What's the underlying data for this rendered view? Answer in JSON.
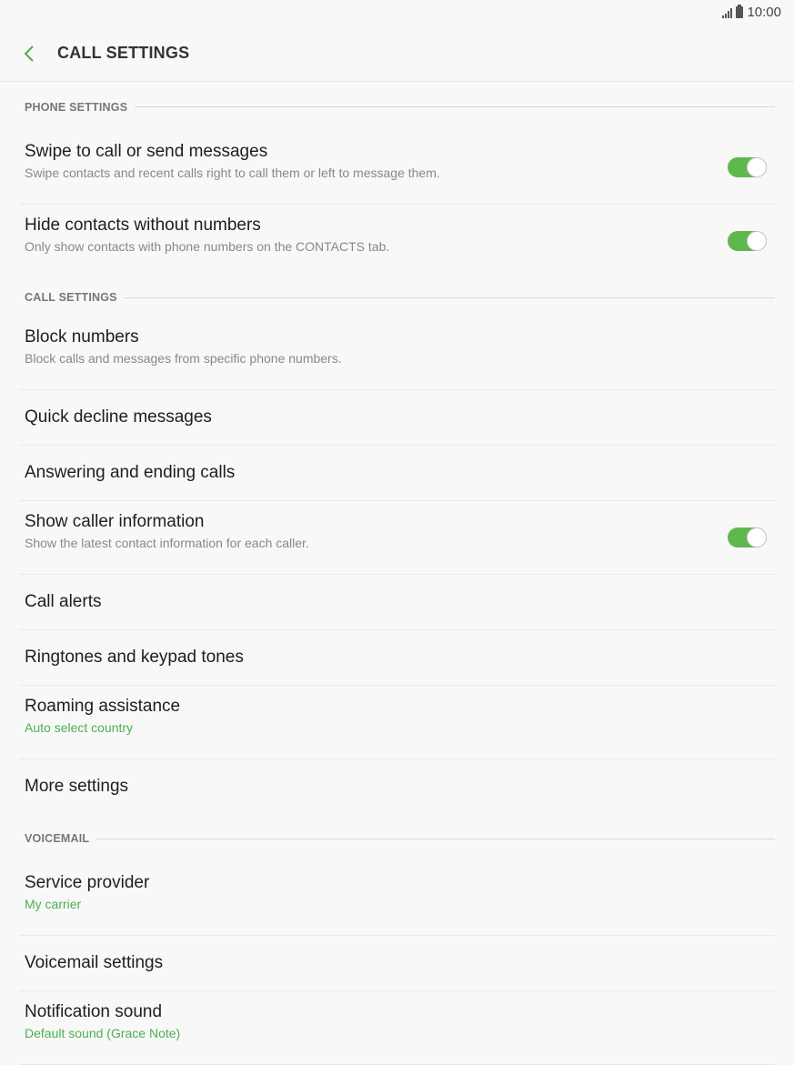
{
  "status_bar": {
    "time": "10:00"
  },
  "header": {
    "title": "CALL SETTINGS"
  },
  "colors": {
    "accent": "#5fb84e",
    "subtext_green": "#4caf50"
  },
  "sections": {
    "phone": {
      "label": "PHONE SETTINGS",
      "items": [
        {
          "title": "Swipe to call or send messages",
          "subtitle": "Swipe contacts and recent calls right to call them or left to message them.",
          "toggle": true
        },
        {
          "title": "Hide contacts without numbers",
          "subtitle": "Only show contacts with phone numbers on the CONTACTS tab.",
          "toggle": true
        }
      ]
    },
    "call": {
      "label": "CALL SETTINGS",
      "items": [
        {
          "title": "Block numbers",
          "subtitle": "Block calls and messages from specific phone numbers."
        },
        {
          "title": "Quick decline messages"
        },
        {
          "title": "Answering and ending calls"
        },
        {
          "title": "Show caller information",
          "subtitle": "Show the latest contact information for each caller.",
          "toggle": true
        },
        {
          "title": "Call alerts"
        },
        {
          "title": "Ringtones and keypad tones"
        },
        {
          "title": "Roaming assistance",
          "subtitle": "Auto select country"
        },
        {
          "title": "More settings"
        }
      ]
    },
    "voicemail": {
      "label": "VOICEMAIL",
      "items": [
        {
          "title": "Service provider",
          "subtitle": "My carrier"
        },
        {
          "title": "Voicemail settings"
        },
        {
          "title": "Notification sound",
          "subtitle": "Default sound (Grace Note)"
        }
      ]
    }
  }
}
